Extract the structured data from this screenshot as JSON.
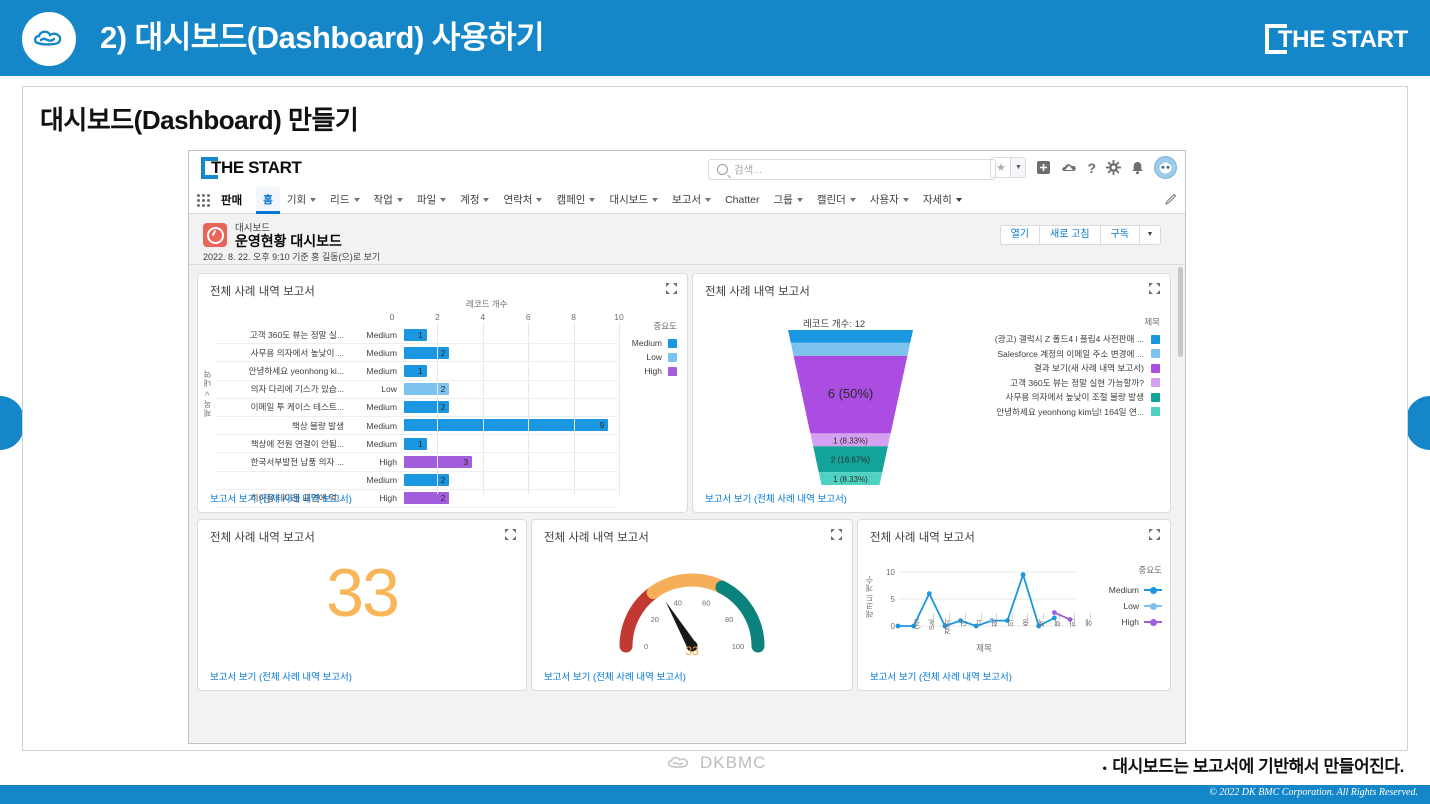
{
  "header": {
    "title": "2) 대시보드(Dashboard) 사용하기",
    "logo_text": "THE START",
    "brand_color": "#1587c8"
  },
  "slide": {
    "section_title": "대시보드(Dashboard) 만들기"
  },
  "salesforce": {
    "logo_text": "THE START",
    "search": {
      "placeholder": "검색...",
      "value": ""
    },
    "header_icons": [
      {
        "name": "favorites-star-icon",
        "glyph": "★"
      },
      {
        "name": "favorites-dropdown-icon",
        "glyph": "▼"
      },
      {
        "name": "add-icon",
        "glyph": "▣"
      },
      {
        "name": "trailhead-cloud-icon",
        "glyph": "☁"
      },
      {
        "name": "help-icon",
        "glyph": "?"
      },
      {
        "name": "setup-gear-icon",
        "glyph": "✿"
      },
      {
        "name": "notifications-bell-icon",
        "glyph": "🔔"
      },
      {
        "name": "user-avatar",
        "glyph": "◕"
      }
    ],
    "app_name": "판매",
    "nav_items": [
      {
        "label": "홈",
        "caret": false,
        "active": true
      },
      {
        "label": "기회",
        "caret": true,
        "active": false
      },
      {
        "label": "리드",
        "caret": true,
        "active": false
      },
      {
        "label": "작업",
        "caret": true,
        "active": false
      },
      {
        "label": "파일",
        "caret": true,
        "active": false
      },
      {
        "label": "계정",
        "caret": true,
        "active": false
      },
      {
        "label": "연락처",
        "caret": true,
        "active": false
      },
      {
        "label": "캠페인",
        "caret": true,
        "active": false
      },
      {
        "label": "대시보드",
        "caret": true,
        "active": false
      },
      {
        "label": "보고서",
        "caret": true,
        "active": false
      },
      {
        "label": "Chatter",
        "caret": false,
        "active": false
      },
      {
        "label": "그룹",
        "caret": true,
        "active": false
      },
      {
        "label": "캘린더",
        "caret": true,
        "active": false
      },
      {
        "label": "사용자",
        "caret": true,
        "active": false
      },
      {
        "label": "자세히",
        "caret": true,
        "active": false
      }
    ],
    "dashboard_header": {
      "kicker": "대시보드",
      "title": "운영현황 대시보드",
      "subtitle": "2022. 8. 22. 오후 9:10 기준 홍 길동(으)로 보기",
      "buttons": [
        "열기",
        "새로 고침",
        "구독"
      ],
      "more_caret": "▼"
    }
  },
  "chart_data": [
    {
      "id": "bar",
      "type": "bar",
      "widget_title": "전체 사례 내역 보고서",
      "footer_link": "보고서 보기 (전체 사례 내역 보고서)",
      "title": "레코드 개수",
      "xlabel": "레코드 개수",
      "ylabel": "제목 > 내역",
      "legend_title": "중요도",
      "xlim": [
        0,
        10
      ],
      "xticks": [
        0,
        2,
        4,
        6,
        8,
        10
      ],
      "legend": [
        {
          "name": "Medium",
          "color": "#1b96e0"
        },
        {
          "name": "Low",
          "color": "#7cc2ef"
        },
        {
          "name": "High",
          "color": "#a25ddc"
        }
      ],
      "rows": [
        {
          "label": "고객 360도 뷰는 정말 실...",
          "priority": "Medium",
          "value": 1,
          "color": "#1b96e0"
        },
        {
          "label": "사무용 의자에서 높낮이 ...",
          "priority": "Medium",
          "value": 2,
          "color": "#1b96e0"
        },
        {
          "label": "안녕하세요 yeonhong ki...",
          "priority": "Medium",
          "value": 1,
          "color": "#1b96e0"
        },
        {
          "label": "의자 다리에 기스가 있습...",
          "priority": "Low",
          "value": 2,
          "color": "#7cc2ef"
        },
        {
          "label": "이메일 투 케이스 테스트...",
          "priority": "Medium",
          "value": 2,
          "color": "#1b96e0"
        },
        {
          "label": "책상 불량 발생",
          "priority": "Medium",
          "value": 9,
          "color": "#1b96e0"
        },
        {
          "label": "책상에 전원 연결이 안됨...",
          "priority": "Medium",
          "value": 1,
          "color": "#1b96e0"
        },
        {
          "label": "한국서부발전 납품 의자 ...",
          "priority": "High",
          "value": 3,
          "color": "#a25ddc"
        },
        {
          "label": "",
          "priority": "Medium",
          "value": 2,
          "color": "#1b96e0"
        },
        {
          "label": "히이용 테이블 표면에 얼...",
          "priority": "High",
          "value": 2,
          "color": "#a25ddc"
        }
      ]
    },
    {
      "id": "funnel",
      "type": "funnel",
      "widget_title": "전체 사례 내역 보고서",
      "footer_link": "보고서 보기 (전체 사례 내역 보고서)",
      "title": "레코드 개수: 12",
      "legend_title": "제목",
      "total": 12,
      "segments": [
        {
          "name": "(광고) 갤럭시 Z 폴드4 l 플립4 사전판매 ...",
          "value": 1,
          "label": "",
          "color": "#1b96e0"
        },
        {
          "name": "Salesforce 계정의 이메일 주소 변경에 ...",
          "value": 1,
          "label": "",
          "color": "#7cc2ef"
        },
        {
          "name": "결과 보기(새 사례 내역 보고서)",
          "value": 6,
          "label": "6 (50%)",
          "color": "#aa4de0"
        },
        {
          "name": "고객 360도 뷰는 정말 실현 가능할까?",
          "value": 1,
          "label": "1 (8.33%)",
          "color": "#d5a0ef"
        },
        {
          "name": "사무용 의자에서 높낮이 조절 불량 발생",
          "value": 2,
          "label": "2 (16.67%)",
          "color": "#12a39a"
        },
        {
          "name": "안녕하세요 yeonhong kim님! 164일 연...",
          "value": 1,
          "label": "1 (8.33%)",
          "color": "#4fd2c2"
        }
      ]
    },
    {
      "id": "metric",
      "type": "metric",
      "widget_title": "전체 사례 내역 보고서",
      "footer_link": "보고서 보기 (전체 사례 내역 보고서)",
      "value": "33",
      "color": "#f9b558"
    },
    {
      "id": "gauge",
      "type": "gauge",
      "widget_title": "전체 사례 내역 보고서",
      "footer_link": "보고서 보기 (전체 사례 내역 보고서)",
      "value": 33,
      "min": 0,
      "max": 100,
      "ticks": [
        0,
        20,
        40,
        60,
        80,
        100
      ],
      "value_label": "33",
      "bands": [
        {
          "from": 0,
          "to": 30,
          "color": "#c23934"
        },
        {
          "from": 30,
          "to": 65,
          "color": "#f7ae59"
        },
        {
          "from": 65,
          "to": 100,
          "color": "#0b827c"
        }
      ]
    },
    {
      "id": "line",
      "type": "line",
      "widget_title": "전체 사례 내역 보고서",
      "footer_link": "보고서 보기 (전체 사례 내역 보고서)",
      "xlabel": "제목",
      "ylabel": "레코드 개수",
      "legend_title": "중요도",
      "yticks": [
        0,
        5,
        10
      ],
      "ylim": [
        0,
        10
      ],
      "categories": [
        "(광...",
        "Sal...",
        "결과...",
        "더...",
        "고...",
        "회...",
        "의...",
        "중...",
        "책...",
        "책...",
        "한...",
        "에..."
      ],
      "series": [
        {
          "name": "Medium",
          "color": "#1b96e0",
          "values": [
            0,
            0,
            6,
            0,
            1,
            0,
            1,
            1,
            9.5,
            0,
            1.5,
            null
          ]
        },
        {
          "name": "Low",
          "color": "#7cc2ef",
          "values": [
            null,
            null,
            null,
            null,
            null,
            null,
            1,
            null,
            null,
            null,
            null,
            null
          ]
        },
        {
          "name": "High",
          "color": "#a25ddc",
          "values": [
            null,
            null,
            null,
            null,
            null,
            null,
            null,
            null,
            null,
            null,
            2.5,
            1.2
          ]
        }
      ]
    }
  ],
  "footer": {
    "logo_text": "DKBMC",
    "bullet": "대시보드는 보고서에 기반해서 만들어진다.",
    "bullet_dot": "•",
    "copyright": "© 2022 DK BMC Corporation. All Rights Reserved."
  }
}
